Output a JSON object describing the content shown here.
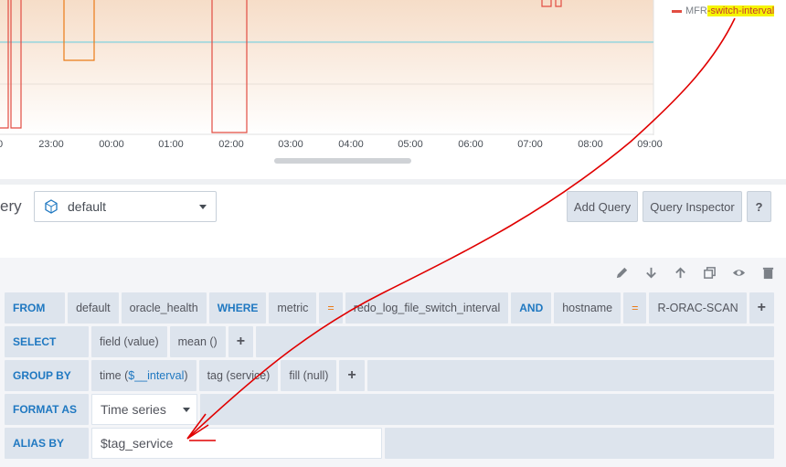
{
  "graph": {
    "x_ticks": [
      "0",
      "23:00",
      "00:00",
      "01:00",
      "02:00",
      "03:00",
      "04:00",
      "05:00",
      "06:00",
      "07:00",
      "08:00",
      "09:00"
    ],
    "legend": {
      "prefix": "MFR",
      "highlight": "-switch-interval"
    },
    "series_color": "#e24d42",
    "step_color": "#eb7b18",
    "baseline_color": "#6ed0e0"
  },
  "query_header": {
    "title": "ery",
    "datasource": "default",
    "add_query": "Add Query",
    "query_inspector": "Query Inspector",
    "help": "?"
  },
  "query": {
    "from": {
      "label": "FROM",
      "db": "default",
      "measurement": "oracle_health",
      "where": "WHERE",
      "tag1": "metric",
      "op1": "=",
      "val1": "redo_log_file_switch_interval",
      "and": "AND",
      "tag2": "hostname",
      "op2": "=",
      "val2": "R-ORAC-SCAN",
      "plus": "+"
    },
    "select": {
      "label": "SELECT",
      "field": "field (value)",
      "agg": "mean ()",
      "plus": "+"
    },
    "group_by": {
      "label": "GROUP BY",
      "time_prefix": "time (",
      "time_var": "$__interval",
      "time_suffix": ")",
      "tag": "tag (service)",
      "fill": "fill (null)",
      "plus": "+"
    },
    "format_as": {
      "label": "FORMAT AS",
      "value": "Time series"
    },
    "alias_by": {
      "label": "ALIAS BY",
      "value": "$tag_service"
    }
  },
  "row_actions": [
    "pencil-icon",
    "arrow-down-icon",
    "arrow-up-icon",
    "duplicate-icon",
    "eye-icon",
    "trash-icon"
  ],
  "annotation_color": "#e00000"
}
